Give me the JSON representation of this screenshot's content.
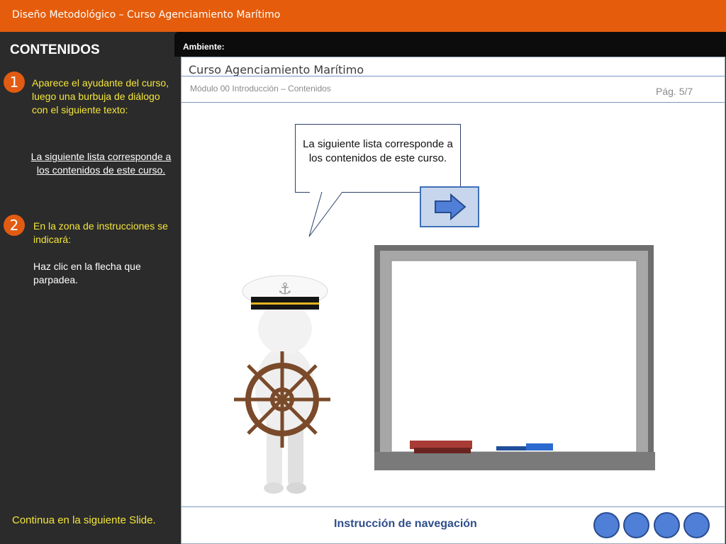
{
  "header": {
    "title": "Diseño  Metodológico – Curso Agenciamiento Marítimo"
  },
  "sidebar": {
    "title": "CONTENIDOS",
    "step1": {
      "number": "1",
      "text": "Aparece el ayudante del curso, luego una burbuja de diálogo con el siguiente texto:",
      "quote": "La siguiente lista corresponde a los contenidos de este curso."
    },
    "step2": {
      "number": "2",
      "text": "En la zona de instrucciones se indicará:",
      "instruction": "Haz clic en la flecha que parpadea."
    },
    "continue": "Continua en la siguiente Slide."
  },
  "ambient": {
    "label": "Ambiente:"
  },
  "panel": {
    "course_title": "Curso Agenciamiento Marítimo",
    "module": "Módulo 00 Introducción – Contenidos",
    "page": "Pág. 5/7",
    "bubble_text": "La siguiente lista corresponde a los contenidos de este curso.",
    "nav_label": "Instrucción de navegación"
  },
  "icons": {
    "next_arrow": "right-arrow-icon",
    "captain": "captain-helm-illustration",
    "board": "whiteboard-illustration"
  },
  "colors": {
    "header_bg": "#e55d0c",
    "sidebar_bg": "#2b2b2b",
    "step_text": "#f5e63a",
    "badge": "#e25b12",
    "nav_circle": "#4f7fd6"
  }
}
